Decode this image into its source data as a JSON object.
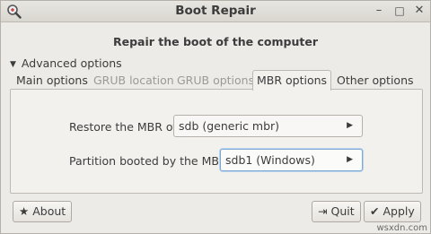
{
  "window": {
    "title": "Boot Repair",
    "minimize": "–",
    "maximize": "□",
    "close": "✕"
  },
  "heading": "Repair the boot of the computer",
  "advanced": {
    "toggle_icon": "▼",
    "label": "Advanced options"
  },
  "tabs": [
    {
      "label": "Main options",
      "state": "normal"
    },
    {
      "label": "GRUB location",
      "state": "disabled"
    },
    {
      "label": "GRUB options",
      "state": "disabled"
    },
    {
      "label": "MBR options",
      "state": "active"
    },
    {
      "label": "Other options",
      "state": "normal"
    }
  ],
  "mbr": {
    "restore_label": "Restore the MBR of:",
    "restore_value": "sdb (generic mbr)",
    "partition_label": "Partition booted by the MBR:",
    "partition_value": "sdb1 (Windows)",
    "arrow": "▶"
  },
  "buttons": {
    "about_icon": "★",
    "about": "About",
    "quit_icon": "⇥",
    "quit": "Quit",
    "apply_icon": "✔",
    "apply": "Apply"
  },
  "watermark": "wsxdn.com",
  "colors": {
    "focus_border": "#7eaad6",
    "window_bg": "#edebe7"
  }
}
